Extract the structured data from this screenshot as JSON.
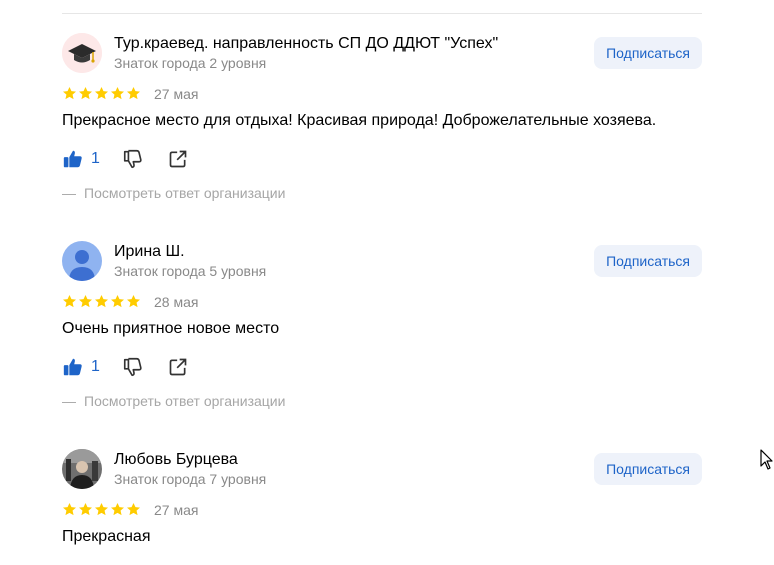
{
  "reviews": [
    {
      "author": "Тур.краевед. направленность СП ДО ДДЮТ \"Успех\"",
      "level": "Знаток города 2 уровня",
      "subscribe_label": "Подписаться",
      "rating": 5,
      "date": "27 мая",
      "text": "Прекрасное место для отдыха! Красивая природа! Доброжелательные хозяева.",
      "likes": "1",
      "org_answer": "Посмотреть ответ организации",
      "avatar": "graduation-cap-icon"
    },
    {
      "author": "Ирина Ш.",
      "level": "Знаток города 5 уровня",
      "subscribe_label": "Подписаться",
      "rating": 5,
      "date": "28 мая",
      "text": "Очень приятное новое место",
      "likes": "1",
      "org_answer": "Посмотреть ответ организации",
      "avatar": "default-user-icon"
    },
    {
      "author": "Любовь Бурцева",
      "level": "Знаток города 7 уровня",
      "subscribe_label": "Подписаться",
      "rating": 5,
      "date": "27 мая",
      "text": "Прекрасная",
      "avatar": "photo"
    }
  ],
  "org_answer_dash": "—",
  "colors": {
    "star": "#fc0",
    "accent": "#1e64c8",
    "subscribe_bg": "#eef2fa",
    "muted": "#898989"
  }
}
